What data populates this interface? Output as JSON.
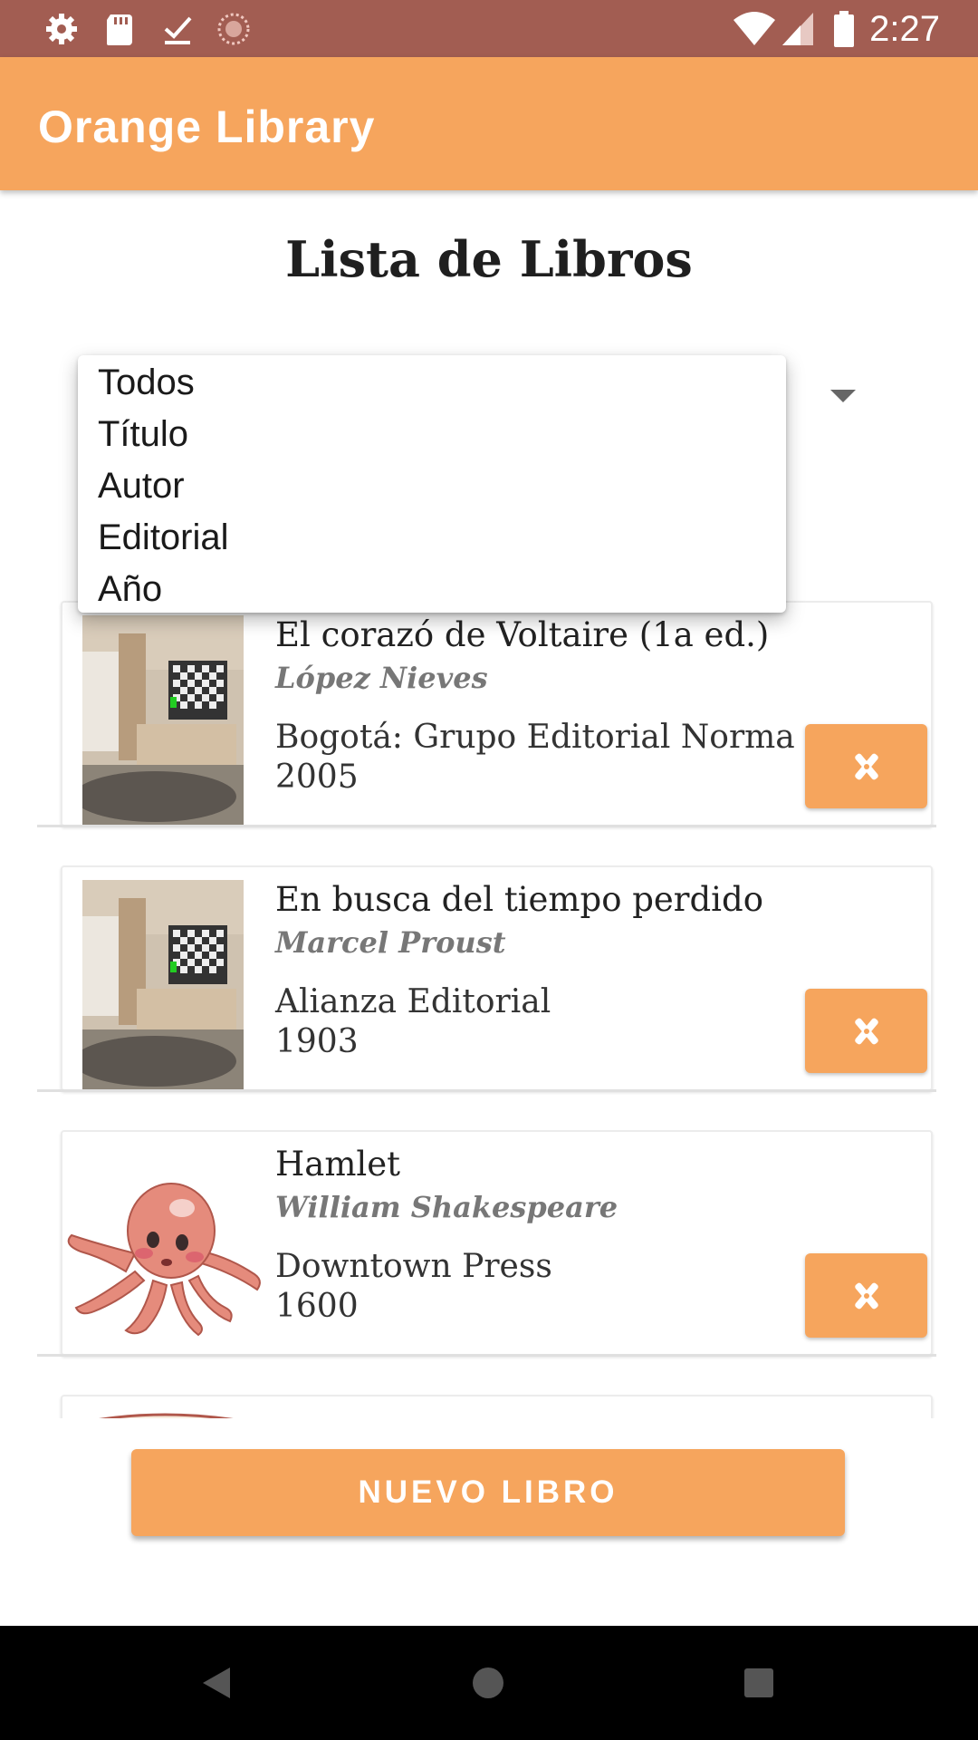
{
  "status_bar": {
    "time": "2:27",
    "left_icons": [
      "gear-icon",
      "sd-card-icon",
      "download-done-icon",
      "sync-icon"
    ],
    "right_icons": [
      "wifi-icon",
      "signal-icon",
      "battery-icon"
    ]
  },
  "app_bar": {
    "title": "Orange Library"
  },
  "page": {
    "title": "Lista de Libros"
  },
  "filter_dropdown": {
    "options": [
      "Todos",
      "Título",
      "Autor",
      "Editorial",
      "Año"
    ]
  },
  "books": [
    {
      "title": "El corazó de Voltaire (1a ed.)",
      "author": "López Nieves",
      "publisher": "Bogotá: Grupo Editorial Norma",
      "year": "2005",
      "cover": "room-cover-image"
    },
    {
      "title": "En busca del tiempo perdido",
      "author": "Marcel Proust",
      "publisher": "Alianza Editorial",
      "year": "1903",
      "cover": "room-cover-image"
    },
    {
      "title": "Hamlet",
      "author": "William Shakespeare",
      "publisher": "Downtown Press",
      "year": "1600",
      "cover": "octopus-cover-image"
    }
  ],
  "actions": {
    "new_book": "NUEVO LIBRO"
  },
  "nav_bar": {
    "buttons": [
      "back-icon",
      "home-icon",
      "recents-icon"
    ]
  },
  "colors": {
    "status_bar": "#a25d52",
    "accent": "#f6a55d",
    "nav_bar": "#000000"
  }
}
